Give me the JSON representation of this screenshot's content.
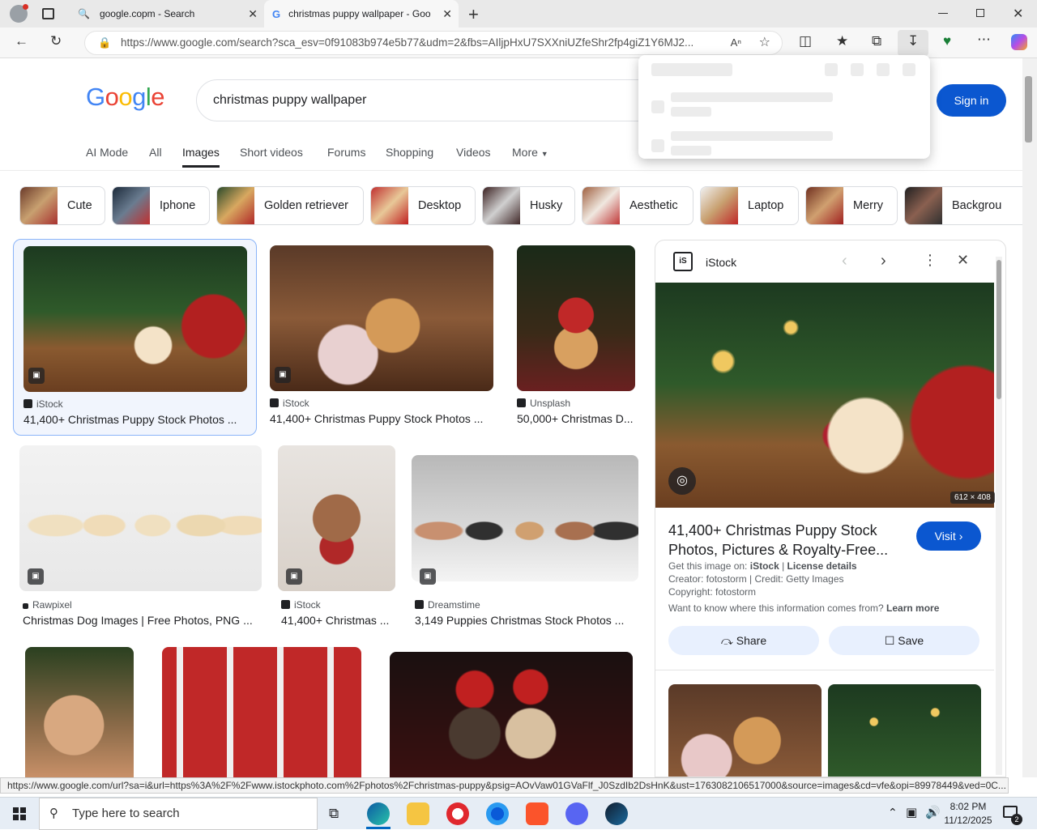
{
  "tabs": [
    {
      "title": "google.copm - Search",
      "icon": "search-icon"
    },
    {
      "title": "christmas puppy wallpaper - Goo",
      "icon": "google-icon"
    }
  ],
  "address": {
    "url": "https://www.google.com/search?sca_esv=0f91083b974e5b77&udm=2&fbs=AIljpHxU7SXXniUZfeShr2fp4giZ1Y6MJ2..."
  },
  "google": {
    "logo": "Google",
    "query": "christmas puppy wallpaper",
    "sign_in": "Sign in",
    "nav": [
      "AI Mode",
      "All",
      "Images",
      "Short videos",
      "Forums",
      "Shopping",
      "Videos",
      "More"
    ]
  },
  "chips": [
    "Cute",
    "Iphone",
    "Golden retriever",
    "Desktop",
    "Husky",
    "Aesthetic",
    "Laptop",
    "Merry",
    "Backgrou"
  ],
  "results": [
    {
      "source": "iStock",
      "title": "41,400+ Christmas Puppy Stock Photos ..."
    },
    {
      "source": "iStock",
      "title": "41,400+ Christmas Puppy Stock Photos ..."
    },
    {
      "source": "Unsplash",
      "title": "50,000+ Christmas D..."
    },
    {
      "source": "Rawpixel",
      "title": "Christmas Dog Images | Free Photos, PNG ..."
    },
    {
      "source": "iStock",
      "title": "41,400+ Christmas ..."
    },
    {
      "source": "Dreamstime",
      "title": "3,149 Puppies Christmas Stock Photos ..."
    }
  ],
  "panel": {
    "source": "iStock",
    "dimensions": "612 × 408",
    "title_line1": "41,400+ Christmas Puppy Stock",
    "title_line2": "Photos, Pictures & Royalty-Free...",
    "visit": "Visit",
    "get_image_on": "Get this image on:",
    "get_image_source": "iStock",
    "license": "License details",
    "creator": "Creator: fotostorm | Credit: Getty Images",
    "copyright": "Copyright: fotostorm",
    "want_to_know": "Want to know where this information comes from?",
    "learn_more": "Learn more",
    "share": "Share",
    "save": "Save"
  },
  "status_url": "https://www.google.com/url?sa=i&url=https%3A%2F%2Fwww.istockphoto.com%2Fphotos%2Fchristmas-puppy&psig=AOvVaw01GVaFlf_J0SzdIb2DsHnK&ust=1763082106517000&source=images&cd=vfe&opi=89978449&ved=0C...",
  "taskbar": {
    "search_placeholder": "Type here to search",
    "time": "8:02 PM",
    "date": "11/12/2025",
    "notifications": "2"
  }
}
